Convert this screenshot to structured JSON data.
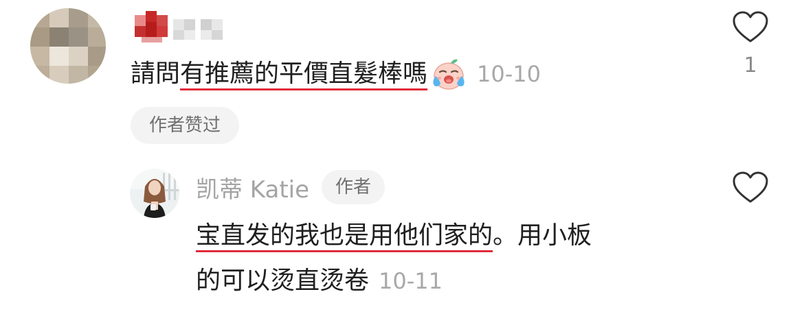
{
  "comment": {
    "underlined_text": "有推薦的平價直髮棒嗎",
    "prefix_text": "請問",
    "emoji_icon": "crying-laughing-face-icon",
    "date": "10-10",
    "badge": "作者赞过",
    "like_count": "1"
  },
  "reply": {
    "author_name": "凯蒂 Katie",
    "author_badge": "作者",
    "line1_underlined": "宝直发的我也是用他们家的",
    "line1_rest": "。用小板",
    "line2": "的可以烫直烫卷",
    "date": "10-11"
  },
  "colors": {
    "underline": "#e02a3a",
    "meta_text": "#a8a8a8",
    "badge_bg": "#f3f3f3",
    "body_text": "#1f1f1f"
  },
  "icons": {
    "like": "heart-outline-icon"
  }
}
